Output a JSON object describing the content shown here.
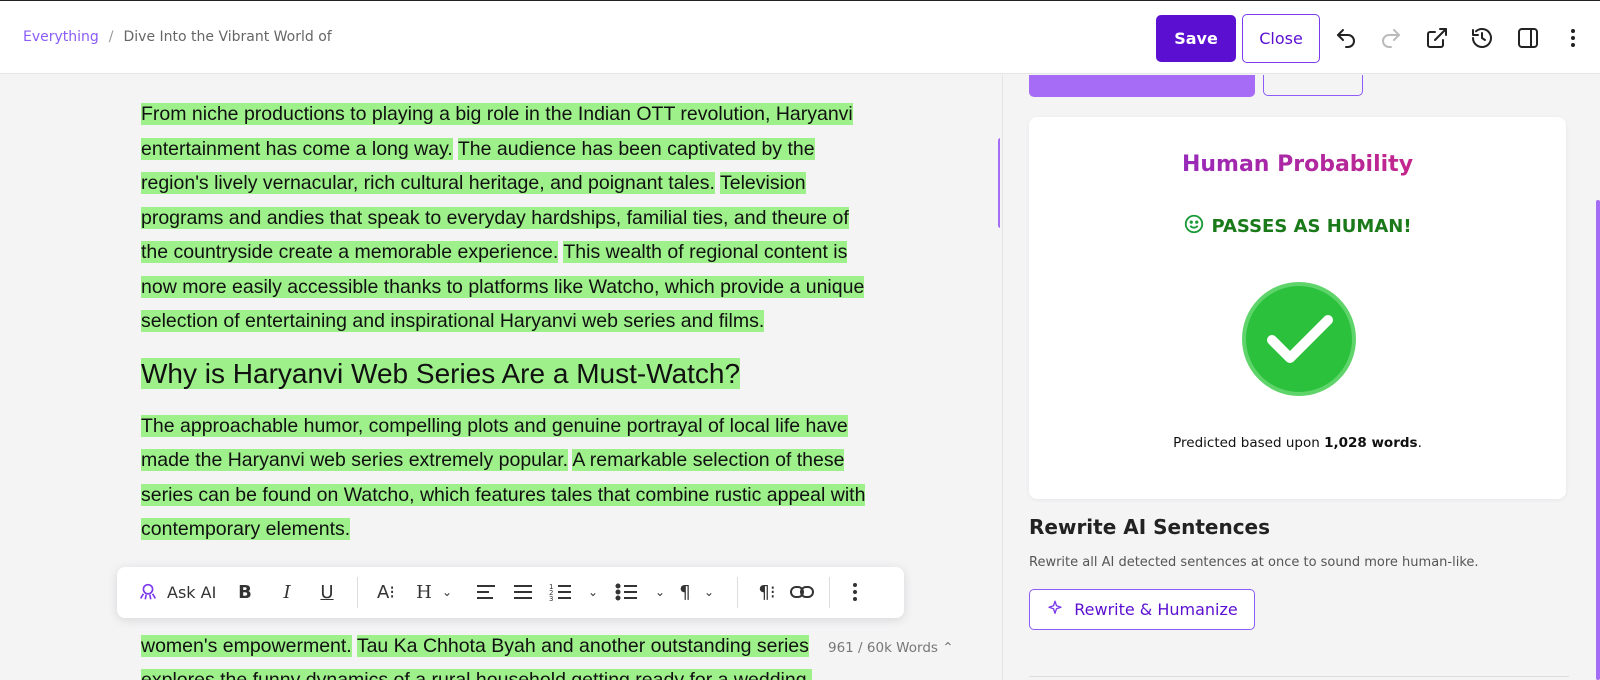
{
  "breadcrumb": {
    "root": "Everything",
    "separator": "/",
    "current": "Dive Into the Vibrant World of"
  },
  "toolbar": {
    "save_label": "Save",
    "close_label": "Close"
  },
  "editor": {
    "para1": [
      "From niche productions to playing a big role in the Indian OTT revolution, Haryanvi entertainment has come a long way.",
      "The audience has been captivated by the region's lively vernacular, rich cultural heritage, and poignant tales.",
      "Television programs and andies that speak to everyday hardships, familial ties, and theure of the countryside create a memorable experience.",
      "This wealth of regional content is now more easily accessible thanks to platforms like Watcho, which provide a unique selection of entertaining and inspirational Haryanvi web series and films."
    ],
    "heading": "Why is Haryanvi Web Series Are a Must-Watch?",
    "para2": [
      "The approachable humor, compelling plots and genuine portrayal of local life have made the Haryanvi web series extremely popular.",
      "A remarkable selection of these series can be found on Watcho, which features tales that combine rustic appeal with contemporary elements."
    ],
    "para3": [
      "women's empowerment.",
      "Tau Ka Chhota Byah and another outstanding series explores the funny dynamics of a rural household getting ready for a wedding."
    ]
  },
  "floating_toolbar": {
    "ask_ai_label": "Ask AI"
  },
  "word_count": "961 / 60k Words",
  "detector": {
    "title": "Human Probability",
    "status": "PASSES AS HUMAN!",
    "footer_prefix": "Predicted based upon ",
    "footer_words": "1,028 words",
    "footer_suffix": "."
  },
  "rewrite": {
    "title": "Rewrite AI Sentences",
    "description": "Rewrite all AI detected sentences at once to sound more human-like.",
    "button_label": "Rewrite & Humanize"
  },
  "colors": {
    "accent": "#5b0fd1",
    "highlight": "#9ef08a",
    "success": "#2bc13d"
  }
}
